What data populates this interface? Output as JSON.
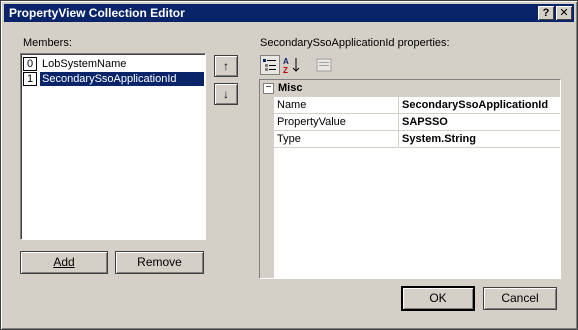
{
  "window": {
    "title": "PropertyView Collection Editor"
  },
  "title_buttons": {
    "help": "?",
    "close": "✕"
  },
  "members": {
    "label": "Members:",
    "items": [
      {
        "index": "0",
        "name": "LobSystemName",
        "selected": false
      },
      {
        "index": "1",
        "name": "SecondarySsoApplicationId",
        "selected": true
      }
    ]
  },
  "move_buttons": {
    "up": "↑",
    "down": "↓"
  },
  "buttons": {
    "add": "Add",
    "remove": "Remove",
    "ok": "OK",
    "cancel": "Cancel"
  },
  "properties": {
    "label": "SecondarySsoApplicationId properties:",
    "category": {
      "toggle": "−",
      "name": "Misc"
    },
    "rows": [
      {
        "key": "Name",
        "value": "SecondarySsoApplicationId"
      },
      {
        "key": "PropertyValue",
        "value": "SAPSSO"
      },
      {
        "key": "Type",
        "value": "System.String"
      }
    ]
  },
  "toolbar_icons": [
    "categorized-icon",
    "alphabetical-icon",
    "property-pages-icon"
  ]
}
